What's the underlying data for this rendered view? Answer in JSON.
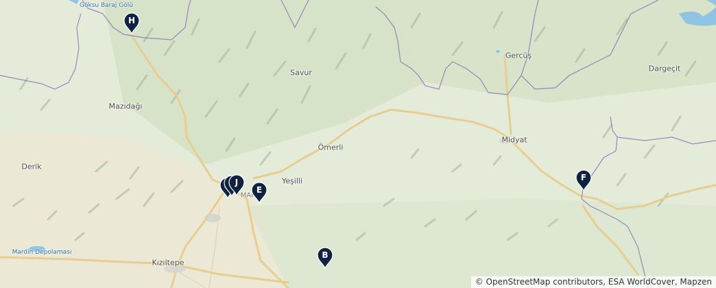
{
  "places": [
    {
      "key": "goksu",
      "label": "Göksu Baraj Gölü",
      "kind": "water"
    },
    {
      "key": "savur",
      "label": "Savur",
      "kind": "town"
    },
    {
      "key": "gercus",
      "label": "Gercüş",
      "kind": "town"
    },
    {
      "key": "dargecit",
      "label": "Dargeçit",
      "kind": "town"
    },
    {
      "key": "mazidagi",
      "label": "Mazıdağı",
      "kind": "town"
    },
    {
      "key": "omerli",
      "label": "Ömerli",
      "kind": "town"
    },
    {
      "key": "midyat",
      "label": "Midyat",
      "kind": "town"
    },
    {
      "key": "derik",
      "label": "Derik",
      "kind": "town"
    },
    {
      "key": "yesilli",
      "label": "Yeşilli",
      "kind": "town"
    },
    {
      "key": "mardin_depolamasi",
      "label": "Mardin Depolaması",
      "kind": "water"
    },
    {
      "key": "kiziltepe",
      "label": "Kızıltepe",
      "kind": "town"
    },
    {
      "key": "mardin_partial",
      "label": "MAI",
      "kind": "city"
    }
  ],
  "markers": [
    {
      "label": "H"
    },
    {
      "label": "A"
    },
    {
      "label": "I"
    },
    {
      "label": "J"
    },
    {
      "label": "E"
    },
    {
      "label": "B"
    },
    {
      "label": "F"
    }
  ],
  "attribution": "© OpenStreetMap contributors, ESA WorldCover, Mapzen",
  "colors": {
    "land": "#e3ebd8",
    "vegetation": "#c7d7b5",
    "hills": "#9aa98f",
    "road": "#e6c987",
    "border": "#8b76b5",
    "water": "#8fc4e3",
    "marker": "#0f2340",
    "marker_text": "#ffffff"
  }
}
